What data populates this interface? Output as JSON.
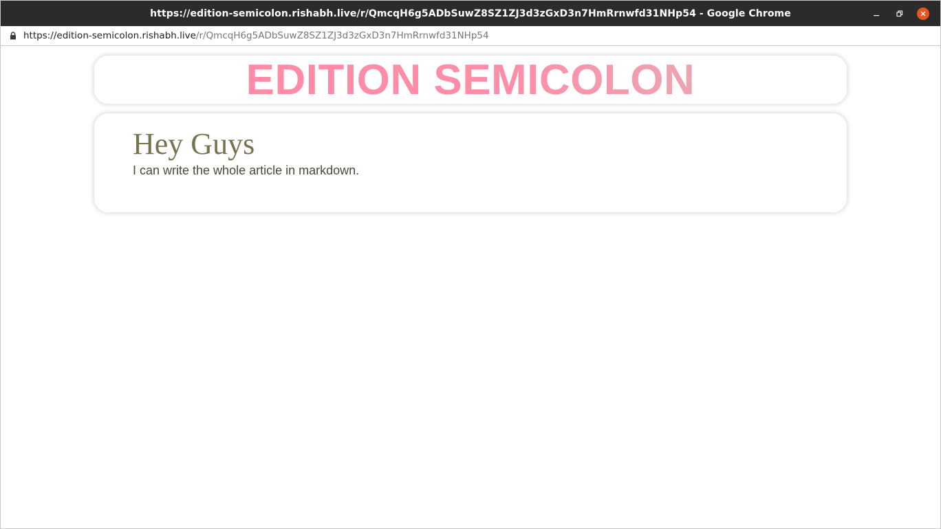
{
  "window": {
    "title": "https://edition-semicolon.rishabh.live/r/QmcqH6g5ADbSuwZ8SZ1ZJ3d3zGxD3n7HmRrnwfd31NHp54 - Google Chrome",
    "controls": [
      "minimize-icon",
      "restore-icon",
      "close-icon"
    ],
    "close_color": "#e95420"
  },
  "address_bar": {
    "host": "https://edition-semicolon.rishabh.live",
    "path": "/r/QmcqH6g5ADbSuwZ8SZ1ZJ3d3zGxD3n7HmRrnwfd31NHp54",
    "icon": "lock-icon"
  },
  "header": {
    "brand": "EDITION SEMICOLON",
    "gradient_colors": [
      "#ff8aa4",
      "#dfb7b9"
    ]
  },
  "article": {
    "title": "Hey Guys",
    "body": "I can write the whole article in markdown.",
    "title_color": "#76744f"
  }
}
